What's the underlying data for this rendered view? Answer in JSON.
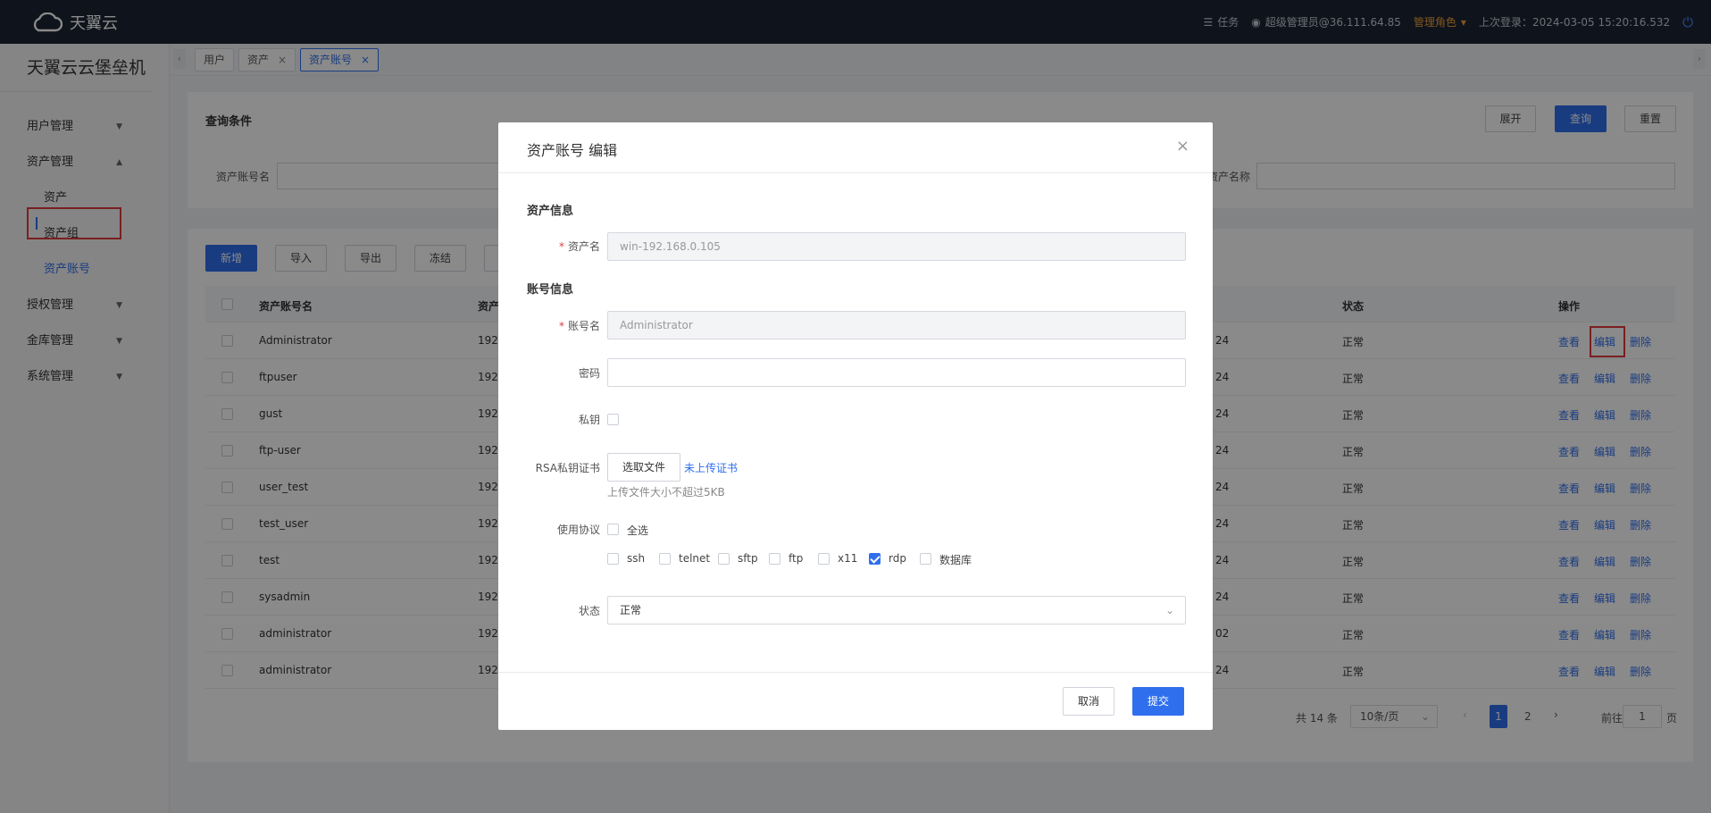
{
  "topbar": {
    "logo_text": "天翼云",
    "tasks_label": "任务",
    "user_label": "超级管理员@36.111.64.85",
    "role_label": "管理角色",
    "last_login": "上次登录：2024-03-05 15:20:16.532"
  },
  "sidebar": {
    "brand": "天翼云云堡垒机",
    "user_mgmt": "用户管理",
    "asset_mgmt": "资产管理",
    "asset": "资产",
    "asset_group": "资产组",
    "asset_account": "资产账号",
    "auth_mgmt": "授权管理",
    "vault_mgmt": "金库管理",
    "system_mgmt": "系统管理"
  },
  "tabs": [
    "用户",
    "资产",
    "资产账号"
  ],
  "query": {
    "title": "查询条件",
    "expand": "展开",
    "search": "查询",
    "reset": "重置",
    "account_label": "资产账号名",
    "asset_name_label": "资产名称"
  },
  "toolbar": {
    "add": "新增",
    "import": "导入",
    "export": "导出",
    "freeze": "冻结"
  },
  "table": {
    "col_account": "资产账号名",
    "col_asset": "资产",
    "col_status": "状态",
    "col_ops": "操作",
    "op_view": "查看",
    "op_edit": "编辑",
    "op_delete": "删除",
    "rows": [
      {
        "account": "Administrator",
        "asset": "192.",
        "mid": "24",
        "status": "正常"
      },
      {
        "account": "ftpuser",
        "asset": "192.",
        "mid": "24",
        "status": "正常"
      },
      {
        "account": "gust",
        "asset": "192.",
        "mid": "24",
        "status": "正常"
      },
      {
        "account": "ftp-user",
        "asset": "192.",
        "mid": "24",
        "status": "正常"
      },
      {
        "account": "user_test",
        "asset": "192.",
        "mid": "24",
        "status": "正常"
      },
      {
        "account": "test_user",
        "asset": "192.",
        "mid": "24",
        "status": "正常"
      },
      {
        "account": "test",
        "asset": "192.",
        "mid": "24",
        "status": "正常"
      },
      {
        "account": "sysadmin",
        "asset": "192.",
        "mid": "24",
        "status": "正常"
      },
      {
        "account": "administrator",
        "asset": "192.",
        "mid": "02",
        "status": "正常"
      },
      {
        "account": "administrator",
        "asset": "192.",
        "mid": "24",
        "status": "正常"
      }
    ]
  },
  "pagination": {
    "total": "共 14 条",
    "page_size": "10条/页",
    "pages": [
      "1",
      "2"
    ],
    "goto": "前往",
    "goto_value": "1",
    "page_unit": "页"
  },
  "modal": {
    "title": "资产账号 编辑",
    "asset_info": "资产信息",
    "asset_name_label": "资产名",
    "asset_name_value": "win-192.168.0.105",
    "account_info": "账号信息",
    "account_name_label": "账号名",
    "account_name_value": "Administrator",
    "password_label": "密码",
    "private_key_label": "私钥",
    "rsa_label": "RSA私钥证书",
    "choose_file": "选取文件",
    "not_uploaded": "未上传证书",
    "upload_hint": "上传文件大小不超过5KB",
    "protocol_label": "使用协议",
    "select_all": "全选",
    "protocols": [
      {
        "name": "ssh",
        "checked": false
      },
      {
        "name": "telnet",
        "checked": false
      },
      {
        "name": "sftp",
        "checked": false
      },
      {
        "name": "ftp",
        "checked": false
      },
      {
        "name": "x11",
        "checked": false
      },
      {
        "name": "rdp",
        "checked": true
      },
      {
        "name": "数据库",
        "checked": false
      }
    ],
    "status_label": "状态",
    "status_value": "正常",
    "cancel": "取消",
    "submit": "提交"
  },
  "colors": {
    "primary": "#2f6fed",
    "topbar": "#1c2434",
    "highlight": "#e23a3a",
    "role": "#f0a23b"
  }
}
